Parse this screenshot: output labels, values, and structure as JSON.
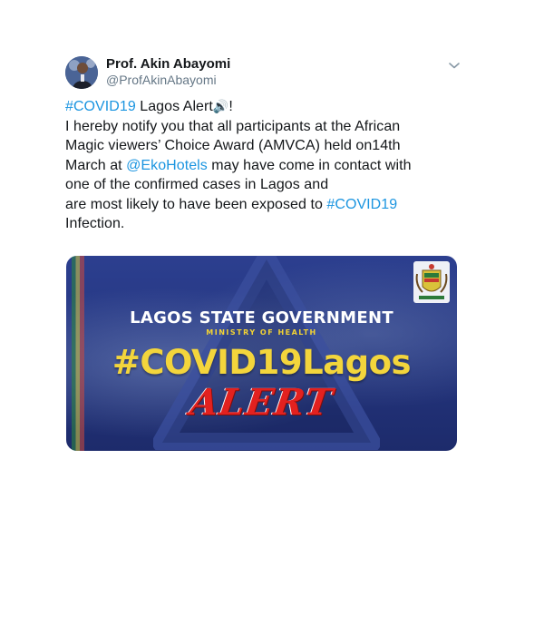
{
  "tweet": {
    "author_name": "Prof. Akin Abayomi",
    "author_handle": "@ProfAkinAbayomi",
    "body": {
      "hashtag_covid": "#COVID19",
      "lagos_alert": " Lagos Alert",
      "speaker_emoji": "🔊",
      "exclaim": "!",
      "line2": "I hereby notify you that all participants at the African",
      "line3": "Magic viewers’ Choice Award (AMVCA) held on14th",
      "line4_pre": "March at ",
      "mention": "@EkoHotels",
      "line4_post": " may have come in contact with",
      "line5": "one of the confirmed cases in Lagos and",
      "line6_pre": "are most likely to have been exposed to ",
      "hashtag_covid_2": "#COVID19",
      "line7": "Infection."
    },
    "media": {
      "gov_title": "LAGOS STATE GOVERNMENT",
      "ministry": "MINISTRY OF HEALTH",
      "hashtag": "#COVID19Lagos",
      "alert": "ALERT"
    }
  },
  "colors": {
    "link": "#1b95e0",
    "handle": "#657786",
    "text": "#14171a",
    "media_blue": "#24357f",
    "hashtag_yellow": "#f3d53c",
    "alert_red": "#e3211f"
  },
  "icons": {
    "options": "chevron-down-icon",
    "speaker": "speaker-emoji-icon",
    "coat_of_arms": "lagos-coat-of-arms-icon"
  }
}
